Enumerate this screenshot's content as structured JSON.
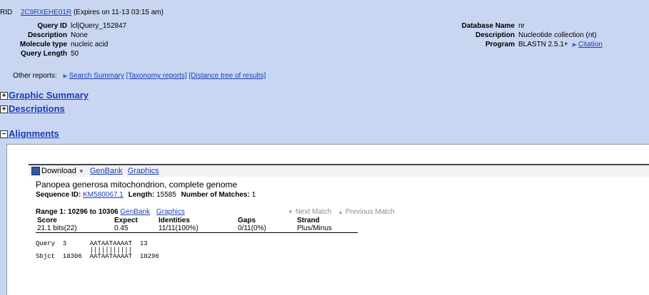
{
  "header": {
    "rid_label": "RID",
    "rid_value": "2C9RXEHE01R",
    "rid_expires": "(Expires on 11-13 03:15 am)",
    "left_fields": [
      {
        "label": "Query ID",
        "value": "lcl|Query_152847"
      },
      {
        "label": "Description",
        "value": "None"
      },
      {
        "label": "Molecule type",
        "value": "nucleic acid"
      },
      {
        "label": "Query Length",
        "value": "50"
      }
    ],
    "right_fields": [
      {
        "label": "Database Name",
        "value": "nr"
      },
      {
        "label": "Description",
        "value": "Nucleotide collection (nt)"
      },
      {
        "label": "Program",
        "value": "BLASTN 2.5.1+"
      }
    ],
    "citation_link": "Citation",
    "other_reports_label": "Other reports:",
    "search_summary": "Search Summary",
    "taxonomy_reports": "[Taxonomy reports]",
    "distance_tree": "[Distance tree of results]"
  },
  "sections": {
    "graphic_summary": "Graphic Summary",
    "descriptions": "Descriptions",
    "alignments": "Alignments"
  },
  "toolbar": {
    "download": "Download",
    "genbank": "GenBank",
    "graphics": "Graphics"
  },
  "hit": {
    "title": "Panopea generosa mitochondrion, complete genome",
    "seqid_label": "Sequence ID:",
    "seqid": "KM580067.1",
    "length_label": "Length:",
    "length": "15585",
    "matches_label": "Number of Matches:",
    "matches": "1",
    "range_label": "Range 1: 10296 to 10306",
    "range_genbank": "GenBank",
    "range_graphics": "Graphics",
    "next_match": "Next Match",
    "prev_match": "Previous Match",
    "stats_headers": [
      "Score",
      "Expect",
      "Identities",
      "Gaps",
      "Strand"
    ],
    "stats_values": [
      "21.1 bits(22)",
      "0.45",
      "11/11(100%)",
      "0/11(0%)",
      "Plus/Minus"
    ],
    "alignment": {
      "query_line": "Query  3      AATAATAAAAT  13",
      "match_line": "              |||||||||||",
      "sbjct_line": "Sbjct  10306  AATAATAAAAT  10296"
    }
  },
  "colors": {
    "header_bg": "#c9d6f2",
    "link": "#1c3fb3",
    "panel_bg": "#ffffff"
  },
  "icons": {
    "expand": "plus-box-icon",
    "collapse": "minus-box-icon",
    "download": "floppy-disk-icon",
    "triangle": "triangle-right-icon"
  }
}
